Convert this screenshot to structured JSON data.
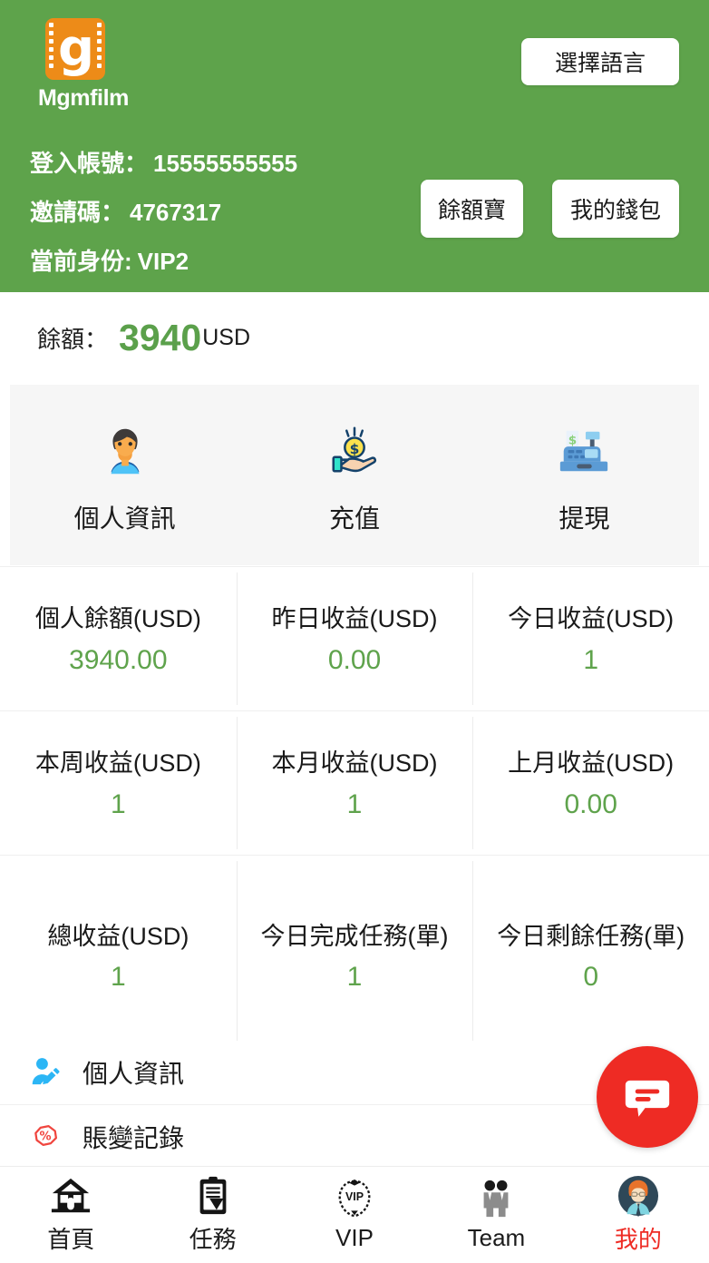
{
  "brand": {
    "logo_letter": "g",
    "name": "Mgmfilm",
    "logo_bg_color": "#ED8B18"
  },
  "theme": {
    "header_green": "#5EA34B",
    "value_green": "#5FA34C",
    "accent_red": "#EE2B24",
    "card_grey": "#F6F6F6"
  },
  "header": {
    "language_button": "選擇語言",
    "account_label": "登入帳號：",
    "account_value": "15555555555",
    "invite_label": "邀請碼：",
    "invite_value": "4767317",
    "identity_label": "當前身份:",
    "identity_value": "VIP2",
    "yuebao_button": "餘額寶",
    "wallet_button": "我的錢包"
  },
  "balance": {
    "label": "餘額：",
    "amount": "3940",
    "currency": "USD"
  },
  "actions": [
    {
      "label": "個人資訊",
      "icon": "person-icon"
    },
    {
      "label": "充值",
      "icon": "hand-coin-icon"
    },
    {
      "label": "提現",
      "icon": "cash-register-icon"
    }
  ],
  "stats": [
    [
      {
        "label": "個人餘額(USD)",
        "value": "3940.00"
      },
      {
        "label": "昨日收益(USD)",
        "value": "0.00"
      },
      {
        "label": "今日收益(USD)",
        "value": "1"
      }
    ],
    [
      {
        "label": "本周收益(USD)",
        "value": "1"
      },
      {
        "label": "本月收益(USD)",
        "value": "1"
      },
      {
        "label": "上月收益(USD)",
        "value": "0.00"
      }
    ],
    [
      {
        "label": "總收益(USD)",
        "value": "1"
      },
      {
        "label": "今日完成任務(單)",
        "value": "1"
      },
      {
        "label": "今日剩餘任務(單)",
        "value": "0"
      }
    ]
  ],
  "menu": [
    {
      "label": "個人資訊",
      "icon": "user-edit-icon"
    },
    {
      "label": "賬變記錄",
      "icon": "percent-tag-icon"
    }
  ],
  "fab": {
    "icon": "chat-bubble-icon"
  },
  "tabbar": [
    {
      "label": "首頁",
      "icon": "home-icon",
      "active": false
    },
    {
      "label": "任務",
      "icon": "clipboard-check-icon",
      "active": false
    },
    {
      "label": "VIP",
      "icon": "vip-wreath-icon",
      "active": false
    },
    {
      "label": "Team",
      "icon": "team-people-icon",
      "active": false
    },
    {
      "label": "我的",
      "icon": "avatar-icon",
      "active": true
    }
  ]
}
